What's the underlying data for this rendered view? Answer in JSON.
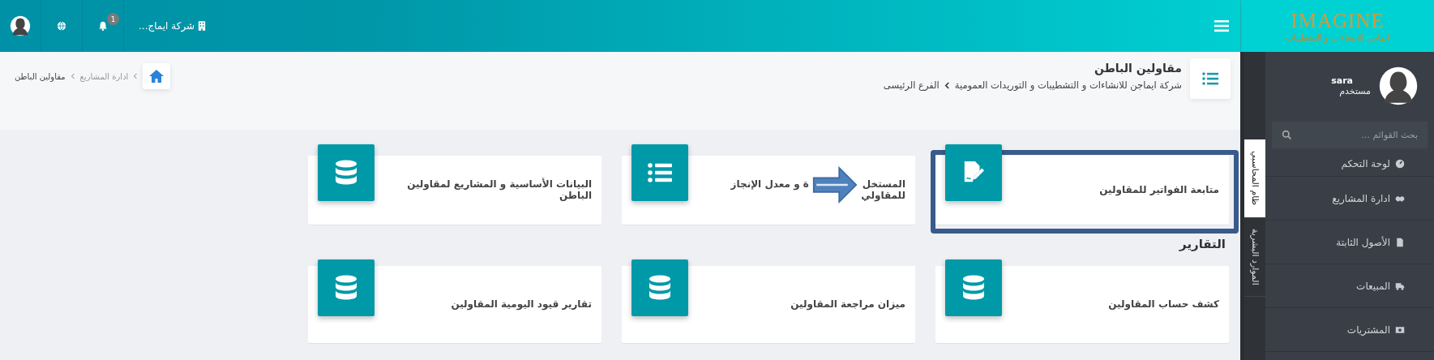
{
  "topbar": {
    "company": "شركة ايماج...",
    "notifications": "1"
  },
  "logo": {
    "brand": "IMAGINE",
    "tagline": "ايماجن للانشاءات و التشطيبات"
  },
  "user": {
    "name": "sara",
    "role": "مستخدم"
  },
  "search": {
    "placeholder": "بحث القوائم ..."
  },
  "menu": [
    {
      "label": "لوحة التحكم"
    },
    {
      "label": "ادارة المشاريع"
    },
    {
      "label": "الأصول الثابتة"
    },
    {
      "label": "المبيعات"
    },
    {
      "label": "المشتريات"
    }
  ],
  "side_tabs": [
    {
      "label": "ظام المحاسبي",
      "selected": true
    },
    {
      "label": "الموارد البشرية",
      "selected": false
    }
  ],
  "header": {
    "title": "مقاولين الباطن",
    "path": [
      "شركة ايماجن للانشاءات و التشطيبات و التوريدات العمومية",
      "الفرع الرئيسى"
    ],
    "breadcrumb": [
      "ادارة المشاريع",
      "مقاولين الباطن"
    ]
  },
  "cards": [
    {
      "lines": [
        [
          "متابعة الفواتير للمقاولين"
        ]
      ],
      "highlighted": true
    },
    {
      "lines": [
        [
          "المستخل",
          "ة و معدل الإنجاز"
        ],
        [
          "للمقاولي"
        ]
      ],
      "highlighted": false,
      "arrow": true
    },
    {
      "lines": [
        [
          "البيانات الأساسية و المشاريع لمقاولين"
        ],
        [
          "الباطن"
        ]
      ],
      "highlighted": false
    }
  ],
  "reports_title": "التقارير",
  "reports": [
    {
      "lines": [
        [
          "كشف حساب المقاولين"
        ]
      ]
    },
    {
      "lines": [
        [
          "ميزان مراجعة المقاولين"
        ]
      ]
    },
    {
      "lines": [
        [
          "تقارير قيود اليومية المقاولين"
        ]
      ]
    }
  ]
}
